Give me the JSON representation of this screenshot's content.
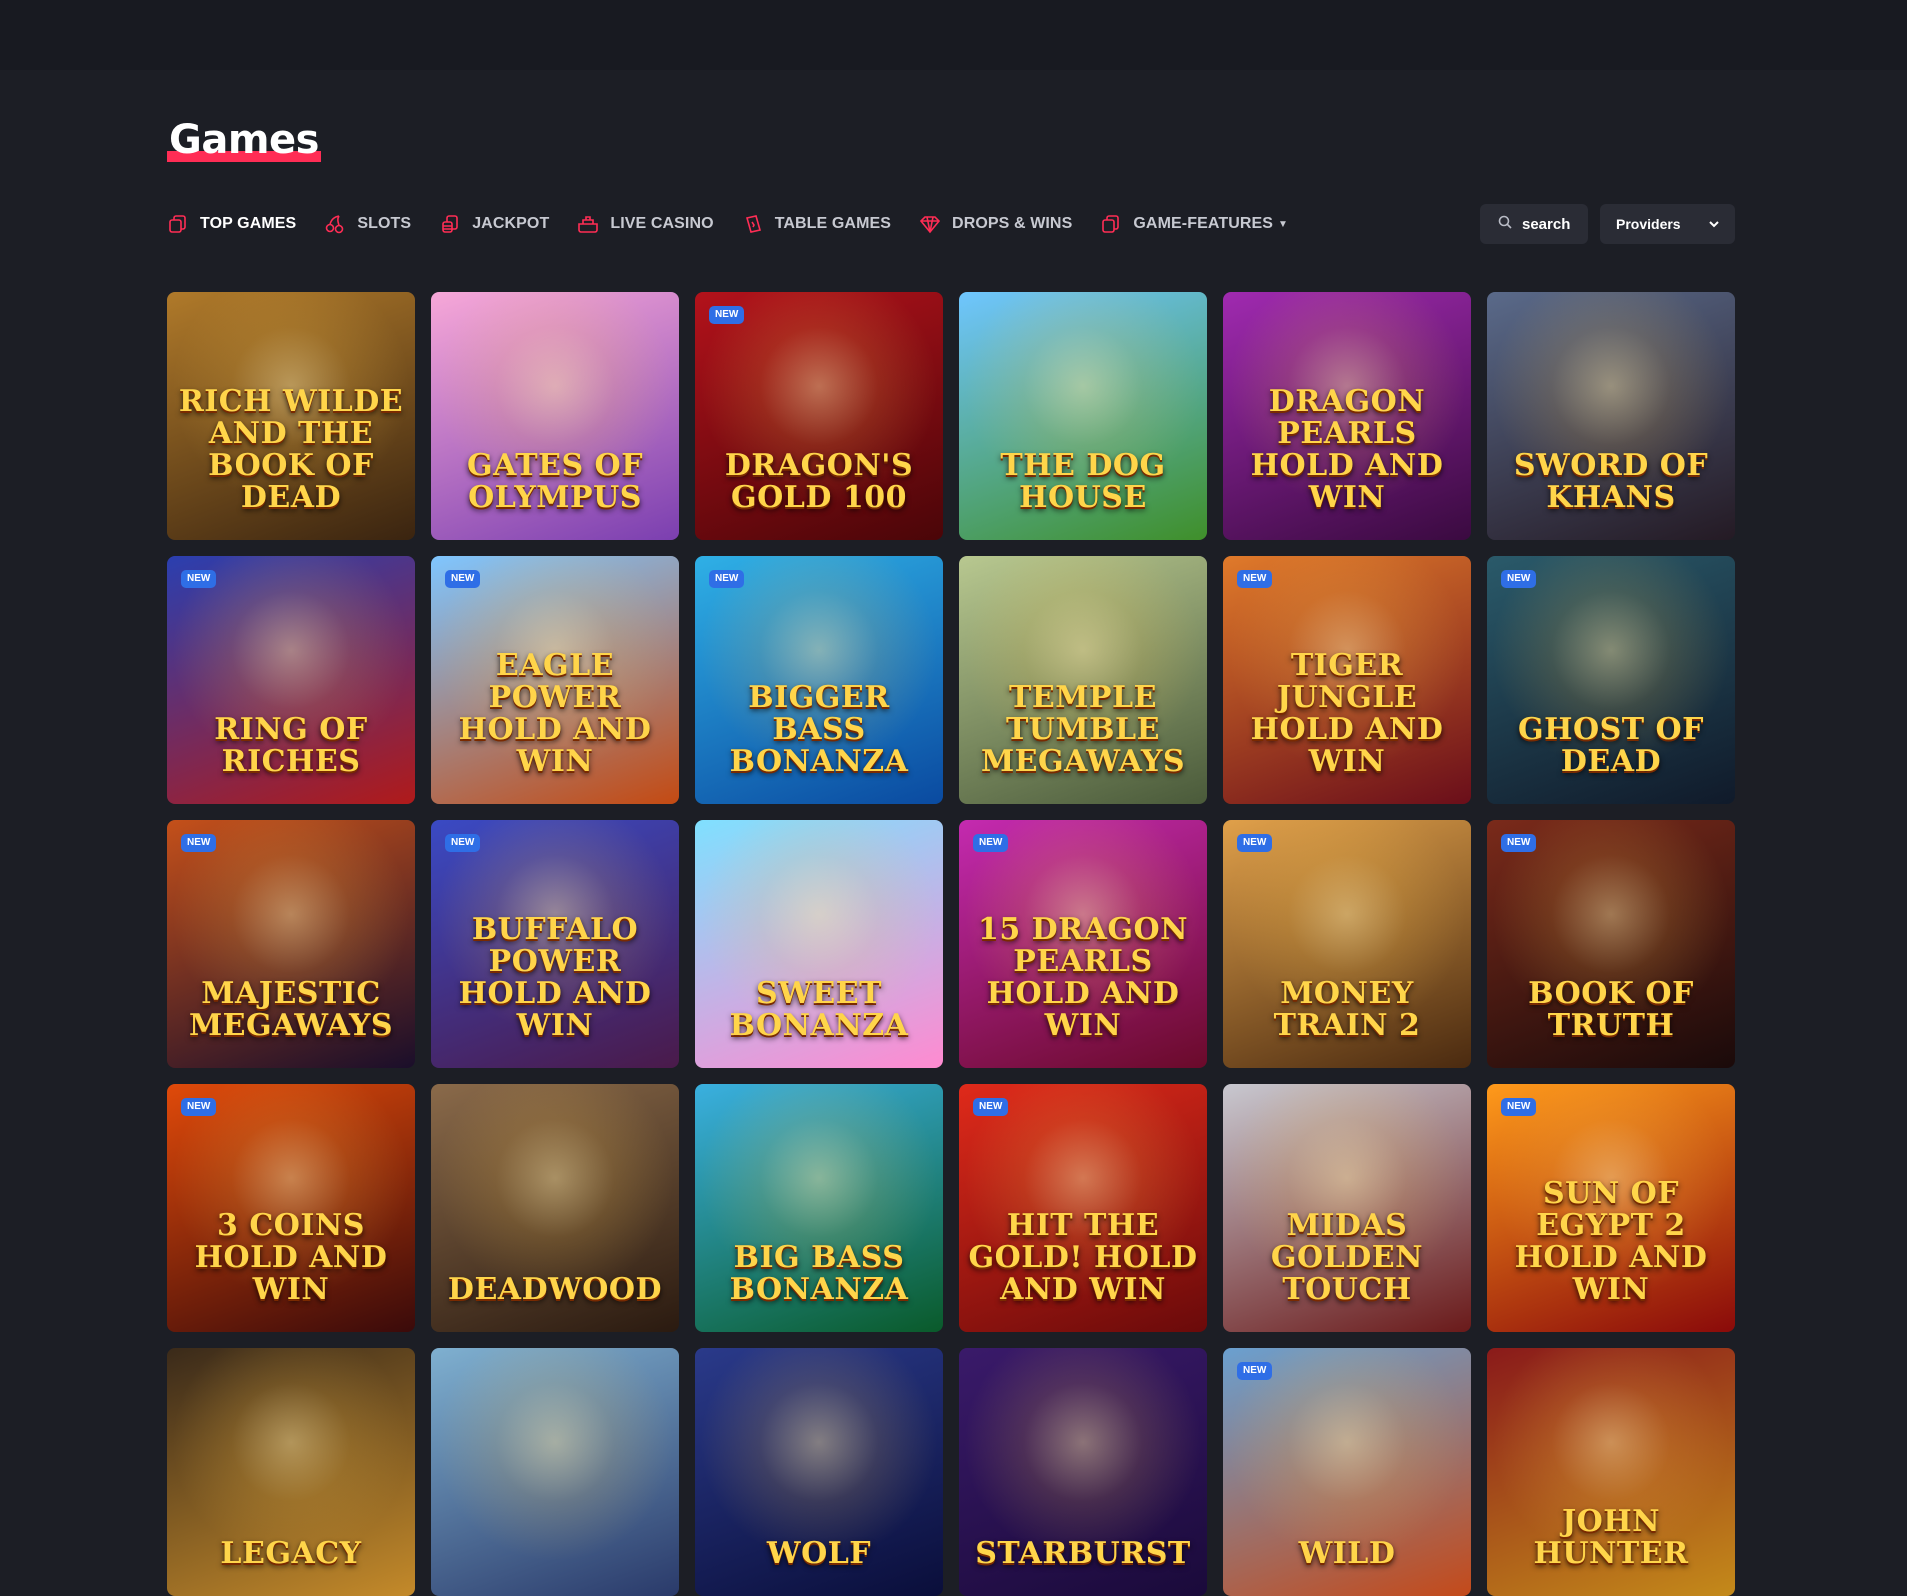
{
  "page": {
    "title": "Games"
  },
  "nav": {
    "items": [
      {
        "label": "TOP GAMES",
        "icon": "cards-icon",
        "active": true
      },
      {
        "label": "SLOTS",
        "icon": "cherries-icon"
      },
      {
        "label": "JACKPOT",
        "icon": "coin-stack-icon"
      },
      {
        "label": "LIVE CASINO",
        "icon": "casino-table-icon"
      },
      {
        "label": "TABLE GAMES",
        "icon": "playing-card-icon"
      },
      {
        "label": "DROPS & WINS",
        "icon": "diamond-icon"
      },
      {
        "label": "GAME-FEATURES",
        "icon": "cards-icon",
        "dropdown": true
      }
    ]
  },
  "search": {
    "label": "search",
    "icon": "search-icon"
  },
  "providers": {
    "label": "Providers",
    "icon": "chevron-down-icon"
  },
  "badge_label": "NEW",
  "accent": "#ff2d55",
  "badge_color": "#2f6ee6",
  "games": [
    {
      "name": "Rich Wilde and the BOOK OF DEAD",
      "new": false,
      "bg": [
        "#b07a2a",
        "#3a2410"
      ]
    },
    {
      "name": "Gates of OLYMPUS",
      "new": false,
      "bg": [
        "#f7a8d8",
        "#7b3fb0"
      ]
    },
    {
      "name": "DRAGON'S GOLD 100",
      "new": true,
      "bg": [
        "#b3121b",
        "#4a0508"
      ]
    },
    {
      "name": "The DOG HOUSE",
      "new": false,
      "bg": [
        "#6fc6ff",
        "#3f8f2a"
      ]
    },
    {
      "name": "DRAGON PEARLS HOLD AND WIN",
      "new": false,
      "bg": [
        "#a02ab0",
        "#3a0a40"
      ]
    },
    {
      "name": "SWORD OF KHANS",
      "new": false,
      "bg": [
        "#5a6a8a",
        "#241a24"
      ]
    },
    {
      "name": "RING OF RICHES",
      "new": true,
      "bg": [
        "#2a3fb0",
        "#b01a1a"
      ]
    },
    {
      "name": "EAGLE POWER HOLD AND WIN",
      "new": true,
      "bg": [
        "#7fc6ff",
        "#c44a12"
      ]
    },
    {
      "name": "BIGGER BASS BONANZA",
      "new": true,
      "bg": [
        "#2fb0e6",
        "#0a4aa0"
      ]
    },
    {
      "name": "TEMPLE TUMBLE MEGAWAYS",
      "new": false,
      "bg": [
        "#b8c890",
        "#4a5a3a"
      ]
    },
    {
      "name": "TIGER JUNGLE HOLD AND WIN",
      "new": true,
      "bg": [
        "#e07a2a",
        "#6a0e1a"
      ]
    },
    {
      "name": "GHOST OF DEAD",
      "new": true,
      "bg": [
        "#2a5a6a",
        "#101a2a"
      ]
    },
    {
      "name": "MAJESTIC MEGAWAYS",
      "new": true,
      "bg": [
        "#c4501a",
        "#1a0e2a"
      ]
    },
    {
      "name": "BUFFALO POWER HOLD AND WIN",
      "new": true,
      "bg": [
        "#3a4ac4",
        "#4a1a4a"
      ]
    },
    {
      "name": "SWEET BONANZA",
      "new": false,
      "bg": [
        "#7fe0ff",
        "#ff8ad0"
      ]
    },
    {
      "name": "15 DRAGON PEARLS HOLD AND WIN",
      "new": true,
      "bg": [
        "#c42ab0",
        "#6a0a2a"
      ]
    },
    {
      "name": "MONEY TRAIN 2",
      "new": true,
      "bg": [
        "#e0a04a",
        "#4a2a10"
      ]
    },
    {
      "name": "BOOK OF TRUTH",
      "new": true,
      "bg": [
        "#7a2a1a",
        "#1a0a0a"
      ]
    },
    {
      "name": "3 COINS HOLD AND WIN",
      "new": true,
      "bg": [
        "#e04a0a",
        "#3a0a0a"
      ]
    },
    {
      "name": "DEADWOOD",
      "new": false,
      "bg": [
        "#8a6a4a",
        "#2a1a10"
      ]
    },
    {
      "name": "BIG BASS BONANZA",
      "new": false,
      "bg": [
        "#3ab0e0",
        "#0a5a2a"
      ]
    },
    {
      "name": "HIT THE GOLD! HOLD AND WIN",
      "new": true,
      "bg": [
        "#e02a1a",
        "#6a0a0a"
      ]
    },
    {
      "name": "MIDAS GOLDEN TOUCH",
      "new": false,
      "bg": [
        "#c8c8d0",
        "#6a1a1a"
      ]
    },
    {
      "name": "SUN OF EGYPT 2 HOLD AND WIN",
      "new": true,
      "bg": [
        "#ff9a1a",
        "#8a0a0a"
      ]
    },
    {
      "name": "LEGACY",
      "new": false,
      "bg": [
        "#3a2a1a",
        "#c48a2a"
      ]
    },
    {
      "name": "",
      "new": false,
      "bg": [
        "#7fb0d0",
        "#2a3a6a"
      ]
    },
    {
      "name": "WOLF",
      "new": false,
      "bg": [
        "#2a3a8a",
        "#0a0e3a"
      ]
    },
    {
      "name": "STARBURST",
      "new": false,
      "bg": [
        "#3a1a6a",
        "#1a0a3a"
      ]
    },
    {
      "name": "WILD",
      "new": true,
      "bg": [
        "#6aa0d0",
        "#c44a1a"
      ]
    },
    {
      "name": "JOHN HUNTER",
      "new": false,
      "bg": [
        "#8a1a1a",
        "#c48a1a"
      ]
    }
  ]
}
